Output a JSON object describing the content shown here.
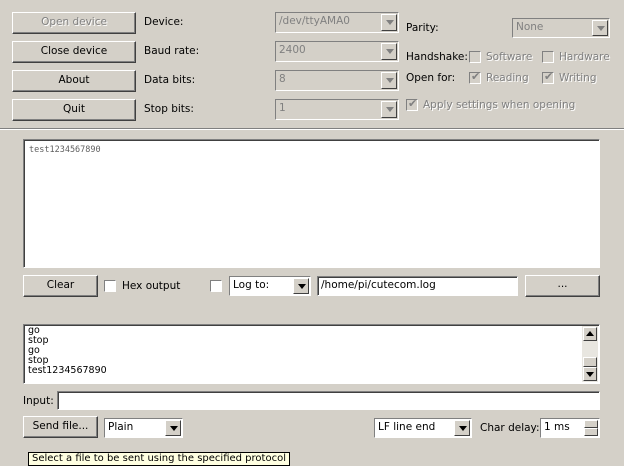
{
  "buttons": {
    "open_device": "Open device",
    "close_device": "Close device",
    "about": "About",
    "quit": "Quit",
    "clear": "Clear",
    "browse": "...",
    "send_file": "Send file..."
  },
  "settings": {
    "device_label": "Device:",
    "device_value": "/dev/ttyAMA0",
    "baud_label": "Baud rate:",
    "baud_value": "2400",
    "databits_label": "Data bits:",
    "databits_value": "8",
    "stopbits_label": "Stop bits:",
    "stopbits_value": "1",
    "parity_label": "Parity:",
    "parity_value": "None",
    "handshake_label": "Handshake:",
    "software_label": "Software",
    "hardware_label": "Hardware",
    "openfor_label": "Open for:",
    "reading_label": "Reading",
    "writing_label": "Writing",
    "apply_label": "Apply settings when opening"
  },
  "output": {
    "text": "test1234567890"
  },
  "controls": {
    "hex_output_label": "Hex output",
    "log_to_label": "Log to:",
    "log_path": "/home/pi/cutecom.log"
  },
  "history": [
    "go",
    "stop",
    "go",
    "stop",
    "test1234567890"
  ],
  "input": {
    "label": "Input:",
    "value": ""
  },
  "bottom": {
    "protocol_value": "Plain",
    "line_end_value": "LF line end",
    "char_delay_label": "Char delay:",
    "char_delay_value": "1 ms"
  },
  "tooltip": "Select a file to be sent using the specified protocol"
}
